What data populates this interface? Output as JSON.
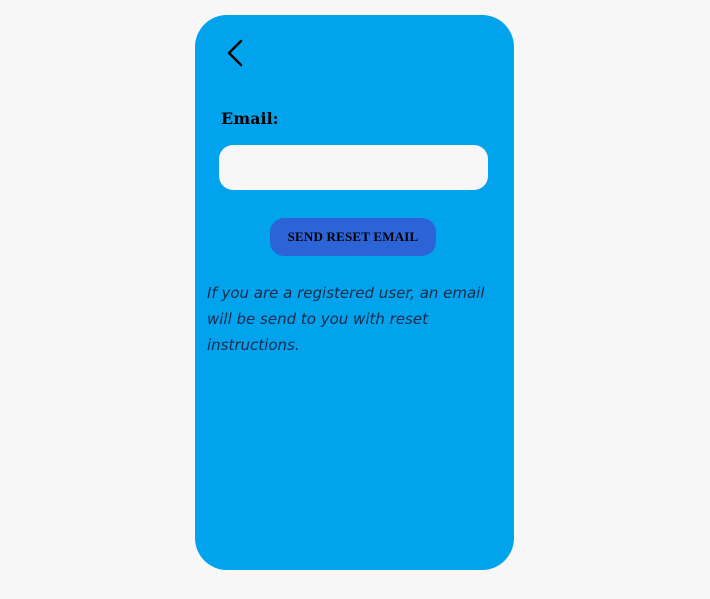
{
  "screen": {
    "back_icon": "chevron-left-icon",
    "email_label": "Email:",
    "email_value": "",
    "email_placeholder": "",
    "reset_button_label": "SEND RESET EMAIL",
    "info_text": "If you are a registered user, an email will be send to you with reset instructions."
  },
  "colors": {
    "page_background": "#f7f7f7",
    "card_background": "#00a3ec",
    "input_background": "#f7f7f7",
    "button_background": "#2c64d8"
  }
}
